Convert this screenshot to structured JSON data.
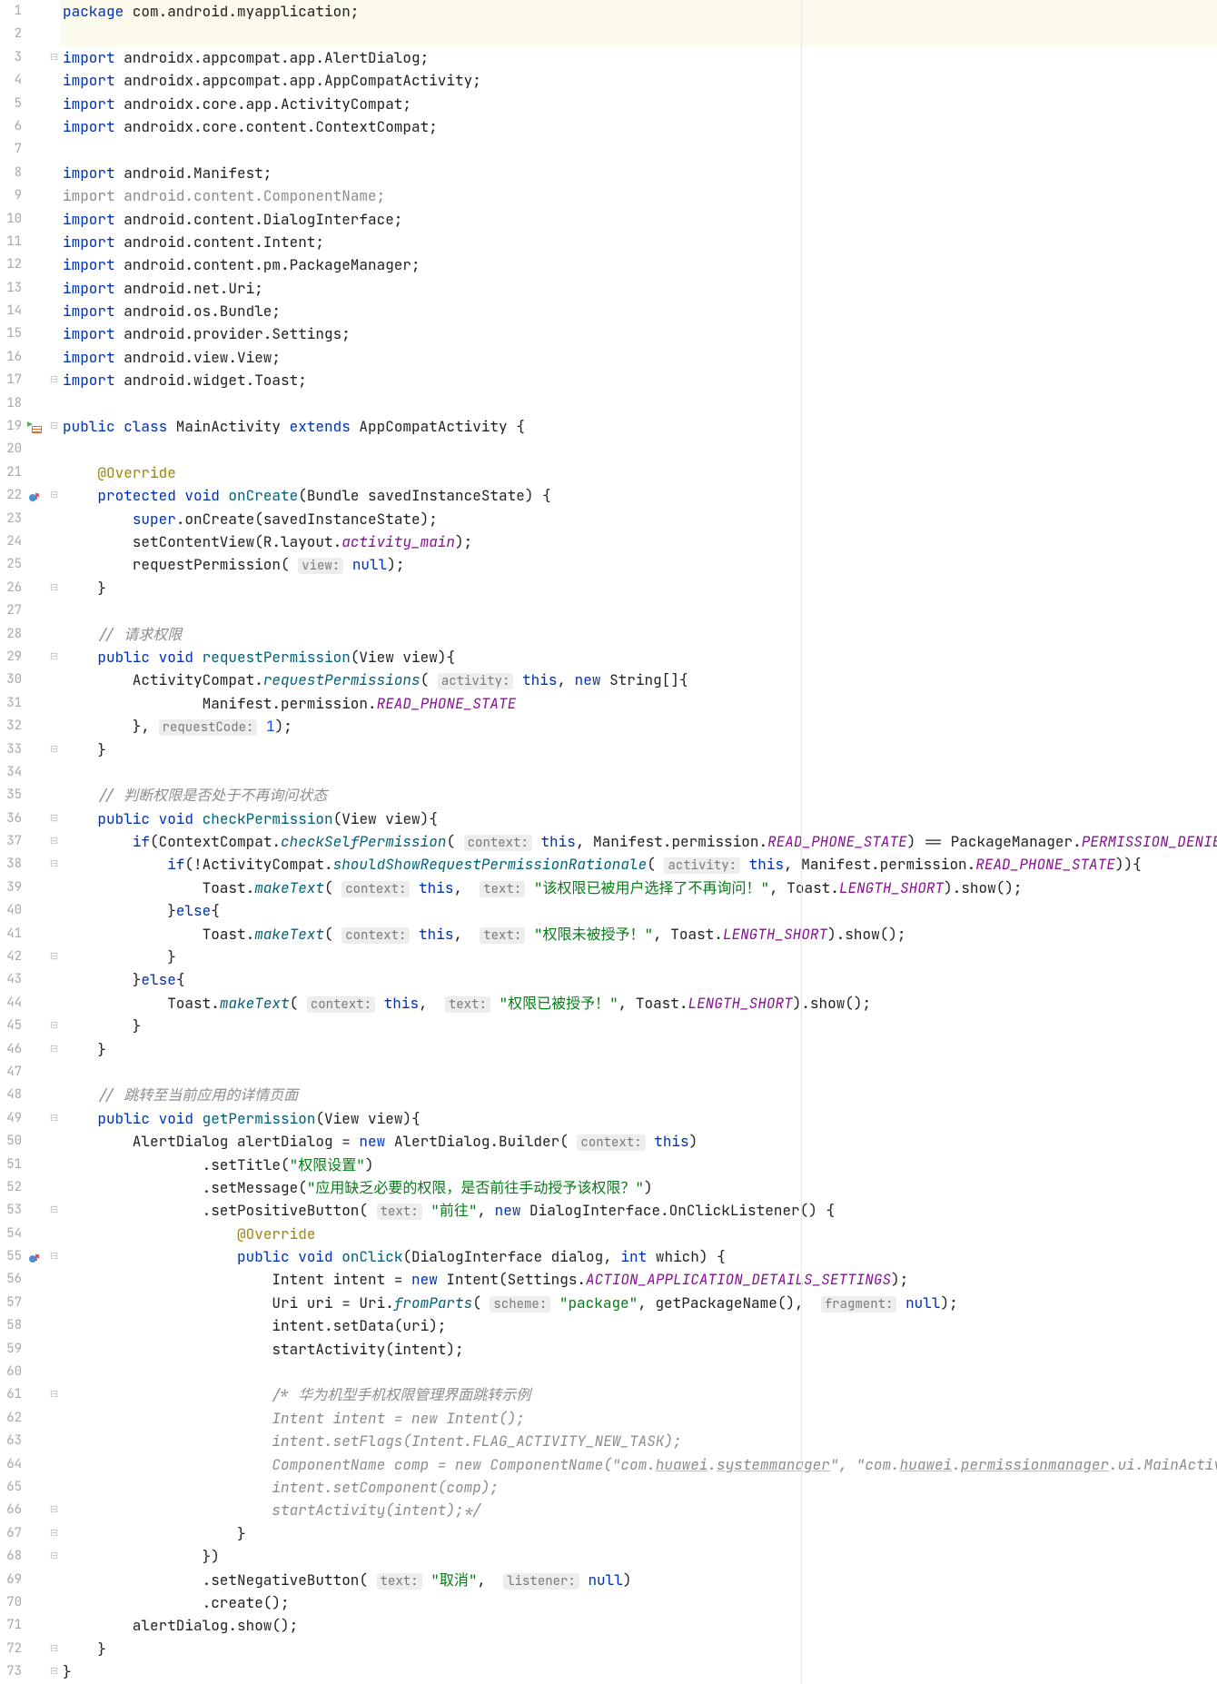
{
  "lines": [
    {
      "n": 1,
      "hl": true,
      "icon": "",
      "fold": "",
      "html": "<span class='kw'>package</span> com.android.myapplication;"
    },
    {
      "n": 2,
      "hl": true,
      "icon": "",
      "fold": "",
      "html": ""
    },
    {
      "n": 3,
      "icon": "",
      "fold": "⊟",
      "html": "<span class='kw'>import</span> androidx.appcompat.app.AlertDialog;"
    },
    {
      "n": 4,
      "icon": "",
      "fold": "",
      "html": "<span class='kw'>import</span> androidx.appcompat.app.AppCompatActivity;"
    },
    {
      "n": 5,
      "icon": "",
      "fold": "",
      "html": "<span class='kw'>import</span> androidx.core.app.ActivityCompat;"
    },
    {
      "n": 6,
      "icon": "",
      "fold": "",
      "html": "<span class='kw'>import</span> androidx.core.content.ContextCompat;"
    },
    {
      "n": 7,
      "icon": "",
      "fold": "",
      "html": ""
    },
    {
      "n": 8,
      "icon": "",
      "fold": "",
      "html": "<span class='kw'>import</span> android.Manifest;"
    },
    {
      "n": 9,
      "icon": "",
      "fold": "",
      "html": "<span class='kw grey'>import</span> <span class='grey'>android.content.ComponentName;</span>"
    },
    {
      "n": 10,
      "icon": "",
      "fold": "",
      "html": "<span class='kw'>import</span> android.content.DialogInterface;"
    },
    {
      "n": 11,
      "icon": "",
      "fold": "",
      "html": "<span class='kw'>import</span> android.content.Intent;"
    },
    {
      "n": 12,
      "icon": "",
      "fold": "",
      "html": "<span class='kw'>import</span> android.content.pm.PackageManager;"
    },
    {
      "n": 13,
      "icon": "",
      "fold": "",
      "html": "<span class='kw'>import</span> android.net.Uri;"
    },
    {
      "n": 14,
      "icon": "",
      "fold": "",
      "html": "<span class='kw'>import</span> android.os.Bundle;"
    },
    {
      "n": 15,
      "icon": "",
      "fold": "",
      "html": "<span class='kw'>import</span> android.provider.Settings;"
    },
    {
      "n": 16,
      "icon": "",
      "fold": "",
      "html": "<span class='kw'>import</span> android.view.View;"
    },
    {
      "n": 17,
      "icon": "",
      "fold": "⊟",
      "html": "<span class='kw'>import</span> android.widget.Toast;"
    },
    {
      "n": 18,
      "icon": "",
      "fold": "",
      "html": ""
    },
    {
      "n": 19,
      "icon": "run",
      "fold": "⊟",
      "html": "<span class='kw'>public class</span> MainActivity <span class='kw'>extends</span> AppCompatActivity {"
    },
    {
      "n": 20,
      "icon": "",
      "fold": "",
      "html": ""
    },
    {
      "n": 21,
      "icon": "",
      "fold": "",
      "html": "    <span class='ann'>@Override</span>"
    },
    {
      "n": 22,
      "icon": "ov",
      "fold": "⊟",
      "html": "    <span class='kw'>protected void</span> <span class='mtd'>onCreate</span>(Bundle savedInstanceState) {"
    },
    {
      "n": 23,
      "icon": "",
      "fold": "",
      "html": "        <span class='kw'>super</span>.onCreate(savedInstanceState);"
    },
    {
      "n": 24,
      "icon": "",
      "fold": "",
      "html": "        setContentView(R.layout.<span class='fld'>activity_main</span>);"
    },
    {
      "n": 25,
      "icon": "",
      "fold": "",
      "html": "        requestPermission( <span class='hint'>view:</span> <span class='kw'>null</span>);"
    },
    {
      "n": 26,
      "icon": "",
      "fold": "⊟",
      "html": "    }"
    },
    {
      "n": 27,
      "icon": "",
      "fold": "",
      "html": ""
    },
    {
      "n": 28,
      "icon": "",
      "fold": "",
      "html": "    <span class='com'>// 请求权限</span>"
    },
    {
      "n": 29,
      "icon": "",
      "fold": "⊟",
      "html": "    <span class='kw'>public void</span> <span class='mtd'>requestPermission</span>(View view){"
    },
    {
      "n": 30,
      "icon": "",
      "fold": "",
      "html": "        ActivityCompat.<span class='mtdi'>requestPermissions</span>( <span class='hint'>activity:</span> <span class='kw'>this</span>, <span class='kw'>new</span> String[]{"
    },
    {
      "n": 31,
      "icon": "",
      "fold": "",
      "html": "                Manifest.permission.<span class='fld'>READ_PHONE_STATE</span>"
    },
    {
      "n": 32,
      "icon": "",
      "fold": "",
      "html": "        }, <span class='hint'>requestCode:</span> <span class='num'>1</span>);"
    },
    {
      "n": 33,
      "icon": "",
      "fold": "⊟",
      "html": "    }"
    },
    {
      "n": 34,
      "icon": "",
      "fold": "",
      "html": ""
    },
    {
      "n": 35,
      "icon": "",
      "fold": "",
      "html": "    <span class='com'>// 判断权限是否处于不再询问状态</span>"
    },
    {
      "n": 36,
      "icon": "",
      "fold": "⊟",
      "html": "    <span class='kw'>public void</span> <span class='mtd'>checkPermission</span>(View view){"
    },
    {
      "n": 37,
      "icon": "",
      "fold": "⊟",
      "html": "        <span class='kw'>if</span>(ContextCompat.<span class='mtdi'>checkSelfPermission</span>( <span class='hint'>context:</span> <span class='kw'>this</span>, Manifest.permission.<span class='fld'>READ_PHONE_STATE</span>) == PackageManager.<span class='fld'>PERMISSION_DENIED</span>){"
    },
    {
      "n": 38,
      "icon": "",
      "fold": "⊟",
      "html": "            <span class='kw'>if</span>(!ActivityCompat.<span class='mtdi'>shouldShowRequestPermissionRationale</span>( <span class='hint'>activity:</span> <span class='kw'>this</span>, Manifest.permission.<span class='fld'>READ_PHONE_STATE</span>)){"
    },
    {
      "n": 39,
      "icon": "",
      "fold": "",
      "html": "                Toast.<span class='mtdi'>makeText</span>( <span class='hint'>context:</span> <span class='kw'>this</span>,  <span class='hint'>text:</span> <span class='str'>\"该权限已被用户选择了不再询问！\"</span>, Toast.<span class='fld'>LENGTH_SHORT</span>).show();"
    },
    {
      "n": 40,
      "icon": "",
      "fold": "",
      "html": "            }<span class='kw'>else</span>{"
    },
    {
      "n": 41,
      "icon": "",
      "fold": "",
      "html": "                Toast.<span class='mtdi'>makeText</span>( <span class='hint'>context:</span> <span class='kw'>this</span>,  <span class='hint'>text:</span> <span class='str'>\"权限未被授予！\"</span>, Toast.<span class='fld'>LENGTH_SHORT</span>).show();"
    },
    {
      "n": 42,
      "icon": "",
      "fold": "⊟",
      "html": "            }"
    },
    {
      "n": 43,
      "icon": "",
      "fold": "",
      "html": "        }<span class='kw'>else</span>{"
    },
    {
      "n": 44,
      "icon": "",
      "fold": "",
      "html": "            Toast.<span class='mtdi'>makeText</span>( <span class='hint'>context:</span> <span class='kw'>this</span>,  <span class='hint'>text:</span> <span class='str'>\"权限已被授予！\"</span>, Toast.<span class='fld'>LENGTH_SHORT</span>).show();"
    },
    {
      "n": 45,
      "icon": "",
      "fold": "⊟",
      "html": "        }"
    },
    {
      "n": 46,
      "icon": "",
      "fold": "⊟",
      "html": "    }"
    },
    {
      "n": 47,
      "icon": "",
      "fold": "",
      "html": ""
    },
    {
      "n": 48,
      "icon": "",
      "fold": "",
      "html": "    <span class='com'>// 跳转至当前应用的详情页面</span>"
    },
    {
      "n": 49,
      "icon": "",
      "fold": "⊟",
      "html": "    <span class='kw'>public void</span> <span class='mtd'>getPermission</span>(View view){"
    },
    {
      "n": 50,
      "icon": "",
      "fold": "",
      "html": "        AlertDialog alertDialog = <span class='kw'>new</span> AlertDialog.Builder( <span class='hint'>context:</span> <span class='kw'>this</span>)"
    },
    {
      "n": 51,
      "icon": "",
      "fold": "",
      "html": "                .setTitle(<span class='str'>\"权限设置\"</span>)"
    },
    {
      "n": 52,
      "icon": "",
      "fold": "",
      "html": "                .setMessage(<span class='str'>\"应用缺乏必要的权限，是否前往手动授予该权限？\"</span>)"
    },
    {
      "n": 53,
      "icon": "",
      "fold": "⊟",
      "html": "                .setPositiveButton( <span class='hint'>text:</span> <span class='str'>\"前往\"</span>, <span class='kw'>new</span> DialogInterface.OnClickListener() {"
    },
    {
      "n": 54,
      "icon": "",
      "fold": "",
      "html": "                    <span class='ann'>@Override</span>"
    },
    {
      "n": 55,
      "icon": "ov",
      "fold": "⊟",
      "html": "                    <span class='kw'>public void</span> <span class='mtd'>onClick</span>(DialogInterface dialog, <span class='kw'>int</span> which) {"
    },
    {
      "n": 56,
      "icon": "",
      "fold": "",
      "html": "                        Intent intent = <span class='kw'>new</span> Intent(Settings.<span class='fld'>ACTION_APPLICATION_DETAILS_SETTINGS</span>);"
    },
    {
      "n": 57,
      "icon": "",
      "fold": "",
      "html": "                        Uri uri = Uri.<span class='mtdi'>fromParts</span>( <span class='hint'>scheme:</span> <span class='str'>\"package\"</span>, getPackageName(),  <span class='hint'>fragment:</span> <span class='kw'>null</span>);"
    },
    {
      "n": 58,
      "icon": "",
      "fold": "",
      "html": "                        intent.setData(uri);"
    },
    {
      "n": 59,
      "icon": "",
      "fold": "",
      "html": "                        startActivity(intent);"
    },
    {
      "n": 60,
      "icon": "",
      "fold": "",
      "html": ""
    },
    {
      "n": 61,
      "icon": "",
      "fold": "⊟",
      "html": "                        <span class='com'>/* 华为机型手机权限管理界面跳转示例</span>"
    },
    {
      "n": 62,
      "icon": "",
      "fold": "",
      "html": "                        <span class='com'>Intent intent = new Intent();</span>"
    },
    {
      "n": 63,
      "icon": "",
      "fold": "",
      "html": "                        <span class='com'>intent.setFlags(Intent.FLAG_ACTIVITY_NEW_TASK);</span>"
    },
    {
      "n": 64,
      "icon": "",
      "fold": "",
      "html": "                        <span class='com'>ComponentName comp = new ComponentName(\"com.<span class='u'>huawei</span>.<span class='u'>systemmanager</span>\", \"com.<span class='u'>huawei</span>.<span class='u'>permissionmanager</span>.ui.MainActivity\");</span>"
    },
    {
      "n": 65,
      "icon": "",
      "fold": "",
      "html": "                        <span class='com'>intent.setComponent(comp);</span>"
    },
    {
      "n": 66,
      "icon": "",
      "fold": "⊟",
      "html": "                        <span class='com'>startActivity(intent);*/</span>"
    },
    {
      "n": 67,
      "icon": "",
      "fold": "⊟",
      "html": "                    }"
    },
    {
      "n": 68,
      "icon": "",
      "fold": "⊟",
      "html": "                })"
    },
    {
      "n": 69,
      "icon": "",
      "fold": "",
      "html": "                .setNegativeButton( <span class='hint'>text:</span> <span class='str'>\"取消\"</span>,  <span class='hint'>listener:</span> <span class='kw'>null</span>)"
    },
    {
      "n": 70,
      "icon": "",
      "fold": "",
      "html": "                .create();"
    },
    {
      "n": 71,
      "icon": "",
      "fold": "",
      "html": "        alertDialog.show();"
    },
    {
      "n": 72,
      "icon": "",
      "fold": "⊟",
      "html": "    }"
    },
    {
      "n": 73,
      "icon": "",
      "fold": "⊟",
      "html": "}"
    }
  ]
}
